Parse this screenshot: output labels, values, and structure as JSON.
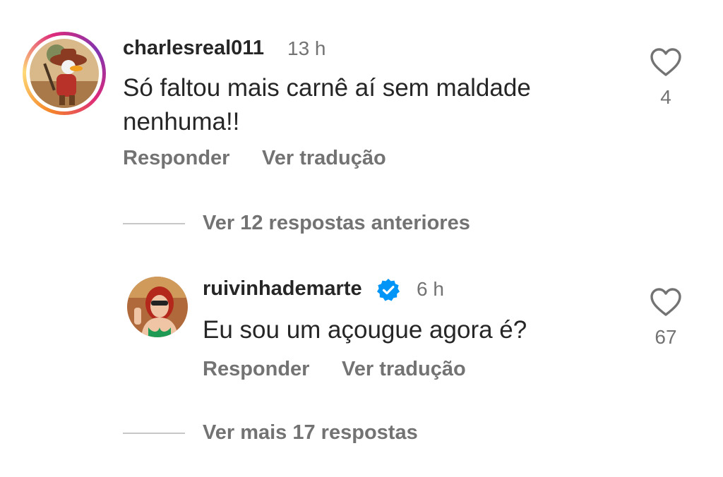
{
  "comments": [
    {
      "username": "charlesreal011",
      "time": "13 h",
      "text_line1": "Só faltou mais carnê aí sem maldade",
      "text_line2": "nenhuma!!",
      "reply_label": "Responder",
      "translate_label": "Ver tradução",
      "likes": "4",
      "avatar": "cartoon-duck-cowboy-avatar",
      "has_story_ring": true
    },
    {
      "username": "ruivinhademarte",
      "verified": true,
      "time": "6 h",
      "text": "Eu sou um açougue agora é?",
      "reply_label": "Responder",
      "translate_label": "Ver tradução",
      "likes": "67",
      "avatar": "user-photo-avatar"
    }
  ],
  "replies_threads": {
    "previous_label": "Ver 12 respostas anteriores",
    "more_label": "Ver mais 17 respostas"
  },
  "icons": {
    "like": "heart-outline-icon",
    "verified": "verified-badge-icon"
  },
  "colors": {
    "text": "#262626",
    "secondary": "#737373",
    "verified_blue": "#0095f6"
  }
}
